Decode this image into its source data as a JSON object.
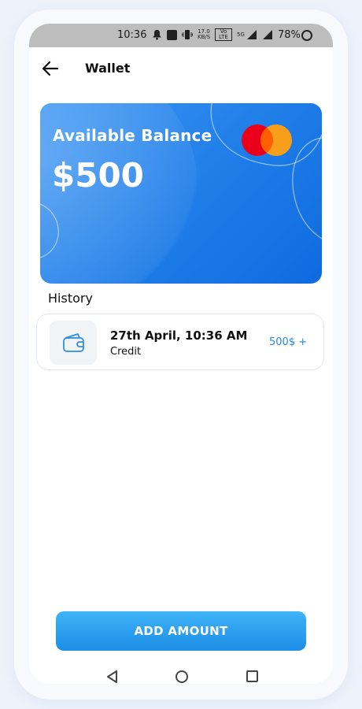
{
  "status_bar": {
    "time": "10:36",
    "speed_top": "17.0",
    "speed_bottom": "KB/S",
    "volte": "Vo LTE",
    "network": "5G",
    "battery": "78%"
  },
  "header": {
    "title": "Wallet",
    "back_icon": "arrow-left-icon"
  },
  "card": {
    "label": "Available Balance",
    "amount": "$500",
    "brand_icon": "mastercard-logo",
    "colors": {
      "gradient_start": "#3c96f3",
      "gradient_end": "#0d6be0"
    }
  },
  "history": {
    "title": "History",
    "items": [
      {
        "date": "27th April, 10:36 AM",
        "type": "Credit",
        "amount": "500$ +",
        "icon": "wallet-icon"
      }
    ]
  },
  "actions": {
    "add_amount_label": "ADD AMOUNT"
  },
  "colors": {
    "accent": "#1b8ee6",
    "amount_text": "#2a86d6"
  }
}
